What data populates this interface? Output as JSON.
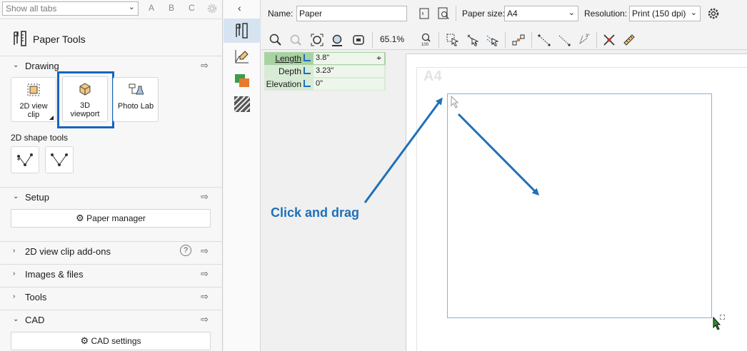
{
  "left_panel": {
    "tab_search": {
      "value": "Show all tabs"
    },
    "filters": [
      "A",
      "B",
      "C"
    ],
    "title": "Paper Tools",
    "drawing": {
      "label": "Drawing",
      "buttons": [
        {
          "label_line1": "2D view",
          "label_line2": "clip"
        },
        {
          "label_line1": "3D",
          "label_line2": "viewport"
        },
        {
          "label_line1": "Photo Lab",
          "label_line2": ""
        }
      ],
      "shape_tools_label": "2D shape tools"
    },
    "setup": {
      "label": "Setup",
      "paper_manager": "Paper manager"
    },
    "sections": [
      {
        "label": "2D view clip add-ons"
      },
      {
        "label": "Images & files"
      },
      {
        "label": "Tools"
      }
    ],
    "cad": {
      "label": "CAD",
      "settings": "CAD settings"
    }
  },
  "toolbar": {
    "name_label": "Name:",
    "name_value": "Paper",
    "paper_size_label": "Paper size:",
    "paper_size_value": "A4",
    "resolution_label": "Resolution:",
    "resolution_value": "Print (150 dpi)",
    "zoom": "65.1%"
  },
  "properties": [
    {
      "key": "Length",
      "value": "3.8\""
    },
    {
      "key": "Depth",
      "value": "3.23\""
    },
    {
      "key": "Elevation",
      "value": "0\""
    }
  ],
  "canvas": {
    "paper_label": "A4",
    "annotation": "Click and drag"
  },
  "colors": {
    "accent": "#1f70b8",
    "selection": "#1565c0",
    "property_bg": "#d8ebd5"
  }
}
